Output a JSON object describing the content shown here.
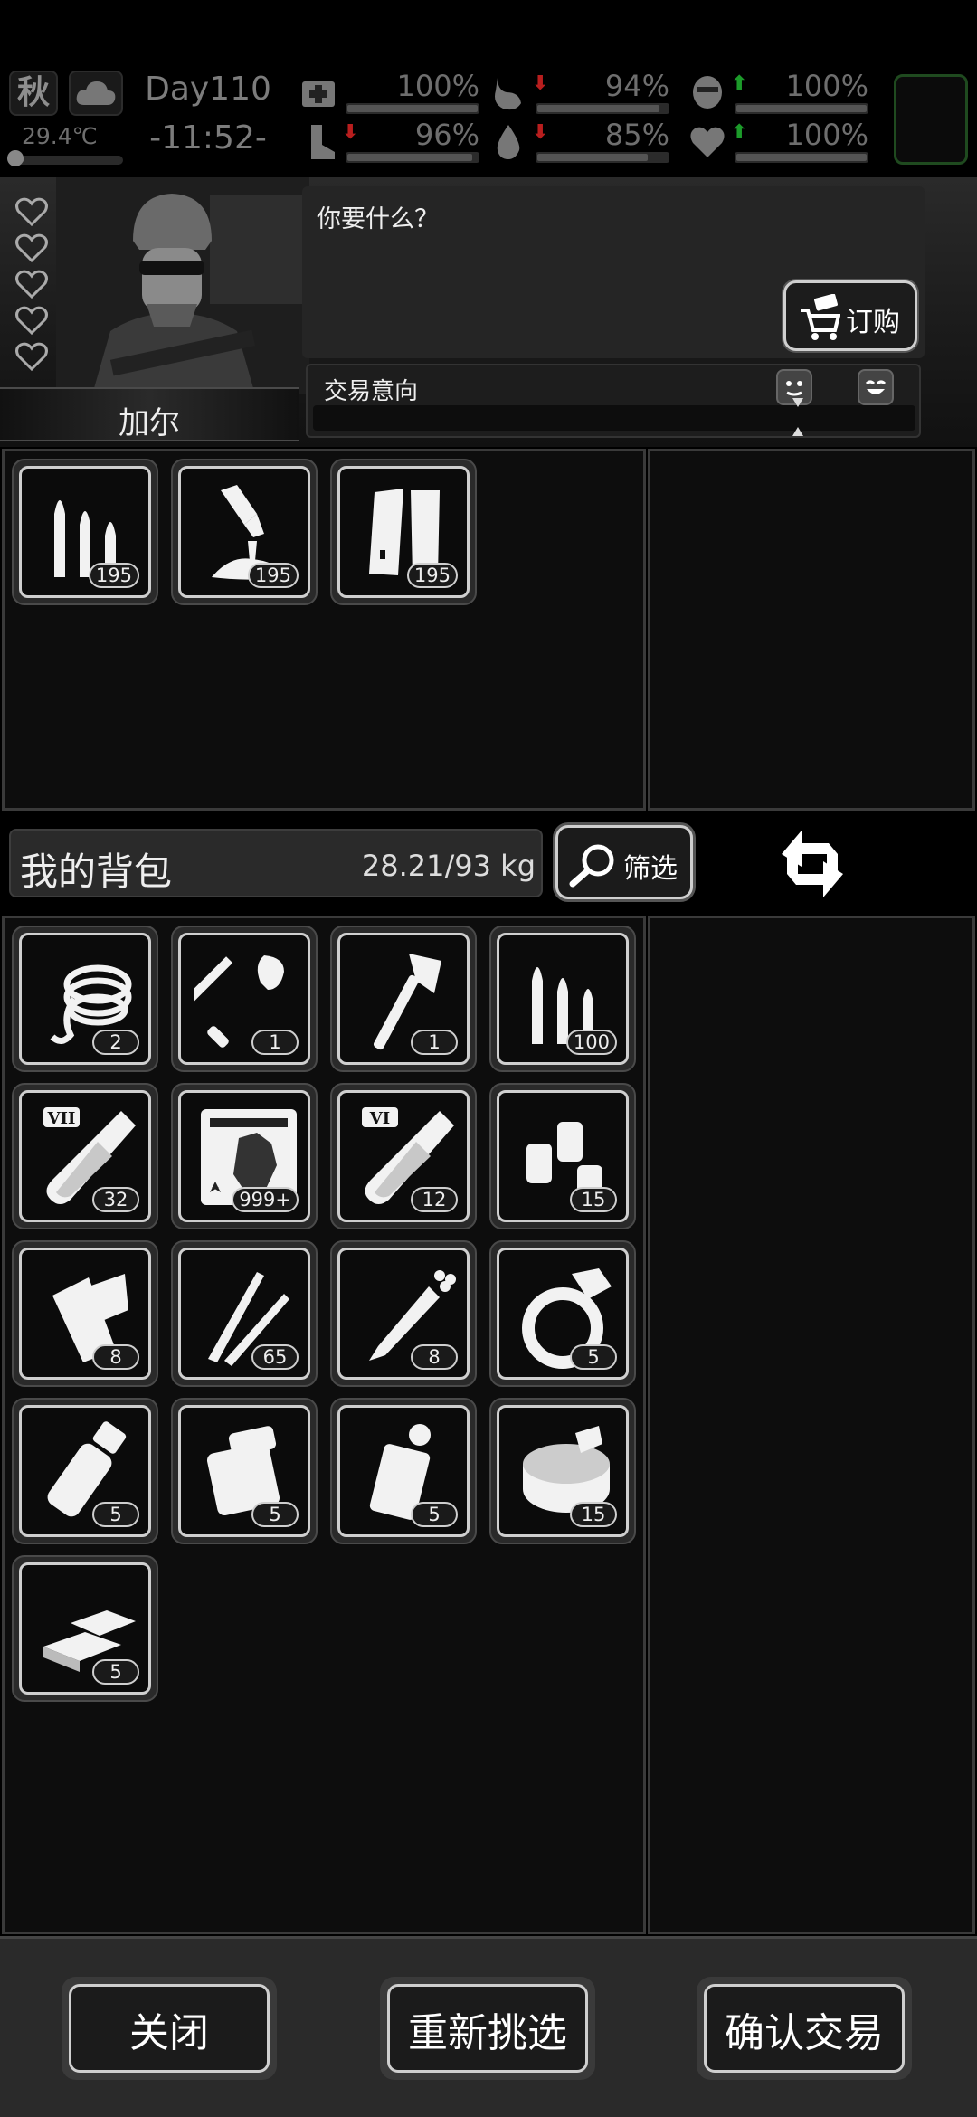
{
  "status": {
    "season": "秋",
    "temperature": "29.4℃",
    "temperature_level": 0.1,
    "day": "Day110",
    "time": "-11:52-",
    "stats": [
      {
        "name": "health",
        "icon": "medkit-icon",
        "value": "100%",
        "level": 1.0,
        "trend": ""
      },
      {
        "name": "hunger",
        "icon": "stomach-icon",
        "value": "94%",
        "level": 0.94,
        "trend": "down"
      },
      {
        "name": "sanity",
        "icon": "brain-icon",
        "value": "100%",
        "level": 1.0,
        "trend": "up"
      },
      {
        "name": "stamina",
        "icon": "leg-icon",
        "value": "96%",
        "level": 0.96,
        "trend": "down"
      },
      {
        "name": "thirst",
        "icon": "water-drop-icon",
        "value": "85%",
        "level": 0.85,
        "trend": "down"
      },
      {
        "name": "mood",
        "icon": "heart-icon",
        "value": "100%",
        "level": 1.0,
        "trend": "up"
      }
    ]
  },
  "npc": {
    "name": "加尔",
    "hearts": 5,
    "dialog": "你要什么？",
    "order_label": "订购",
    "intent_label": "交易意向"
  },
  "merchant_items": [
    {
      "icon": "rifle-ammo-icon",
      "count": "195"
    },
    {
      "icon": "shotgun-shells-spill-icon",
      "count": "195"
    },
    {
      "icon": "magazine-clips-icon",
      "count": "195"
    }
  ],
  "backpack": {
    "title": "我的背包",
    "weight": "28.21/93 kg",
    "filter_label": "筛选",
    "items": [
      {
        "icon": "rope-hook-icon",
        "count": "2"
      },
      {
        "icon": "shovel-icon",
        "count": "1"
      },
      {
        "icon": "hatchet-icon",
        "count": "1"
      },
      {
        "icon": "rifle-ammo-icon",
        "count": "100"
      },
      {
        "icon": "test-tube-vii-icon",
        "count": "32"
      },
      {
        "icon": "zombie-card-icon",
        "count": "999+"
      },
      {
        "icon": "test-tube-vi-icon",
        "count": "12"
      },
      {
        "icon": "shotgun-shells-icon",
        "count": "15"
      },
      {
        "icon": "bandage-roll-icon",
        "count": "8"
      },
      {
        "icon": "sniper-rounds-icon",
        "count": "65"
      },
      {
        "icon": "syringe-icon",
        "count": "8"
      },
      {
        "icon": "diamond-ring-icon",
        "count": "5"
      },
      {
        "icon": "grenade-icon",
        "count": "5"
      },
      {
        "icon": "incendiary-canister-icon",
        "count": "5"
      },
      {
        "icon": "frag-grenade-icon",
        "count": "5"
      },
      {
        "icon": "canned-food-icon",
        "count": "15"
      },
      {
        "icon": "gold-bars-icon",
        "count": "5"
      }
    ]
  },
  "footer": {
    "close_label": "关闭",
    "reselect_label": "重新挑选",
    "confirm_label": "确认交易"
  },
  "colors": {
    "trend_down": "#b81e1e",
    "trend_up": "#1c9b2a",
    "item_border": "#cfcfcf"
  }
}
